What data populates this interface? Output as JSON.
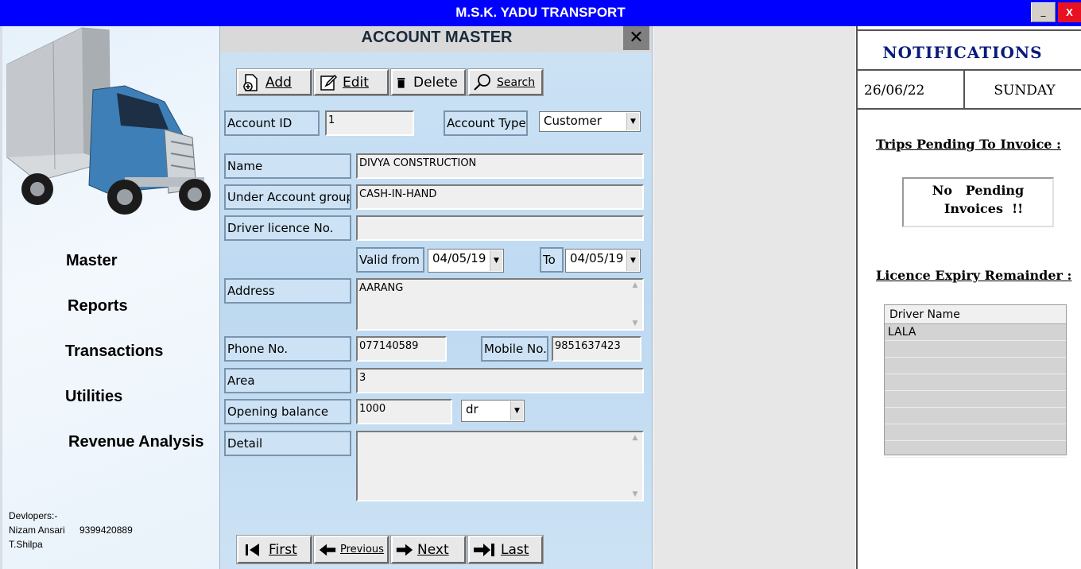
{
  "window": {
    "title": "M.S.K. YADU TRANSPORT",
    "minimize_label": "_",
    "close_label": "X"
  },
  "sidebar": {
    "menu": [
      "Master",
      "Reports",
      "Transactions",
      "Utilities",
      "Revenue Analysis"
    ],
    "developers_heading": "Devlopers:-",
    "developer_1": "Nizam Ansari",
    "developer_1_phone": "9399420889",
    "developer_2": "T.Shilpa"
  },
  "account_master": {
    "title": "ACCOUNT MASTER",
    "close_label": "✕",
    "toolbar": {
      "add": "Add",
      "edit": "Edit",
      "delete": "Delete",
      "search": "Search"
    },
    "labels": {
      "account_id": "Account ID",
      "account_type": "Account Type",
      "name": "Name",
      "under_group": "Under Account group",
      "driver_licence": "Driver licence No.",
      "valid_from": "Valid from",
      "to": "To",
      "address": "Address",
      "phone": "Phone No.",
      "mobile": "Mobile No.",
      "area": "Area",
      "opening_balance": "Opening balance",
      "detail": "Detail"
    },
    "values": {
      "account_id": "1",
      "account_type": "Customer",
      "name": "DIVYA CONSTRUCTION",
      "under_group": "CASH-IN-HAND",
      "driver_licence": "",
      "valid_from": "04/05/19",
      "to": "04/05/19",
      "address": "AARANG",
      "phone": "077140589",
      "mobile": "9851637423",
      "area": "3",
      "opening_balance": "1000",
      "balance_type": "dr",
      "detail": ""
    },
    "nav": {
      "first": "First",
      "previous": "Previous",
      "next": "Next",
      "last": "Last"
    }
  },
  "notifications": {
    "title": "NOTIFICATIONS",
    "date": "26/06/22",
    "day": "SUNDAY",
    "trips_heading": "Trips Pending To Invoice :",
    "pending_line1": "No   Pending",
    "pending_line2": "Invoices  !!",
    "licence_heading": "Licence Expiry Remainder :",
    "grid_header": "Driver Name",
    "grid_rows": [
      "LALA",
      "",
      "",
      "",
      "",
      "",
      "",
      ""
    ]
  },
  "colors": {
    "titlebar": "#0000ff",
    "panel": "#cde3f5",
    "notif_title": "#0a1a7a"
  }
}
